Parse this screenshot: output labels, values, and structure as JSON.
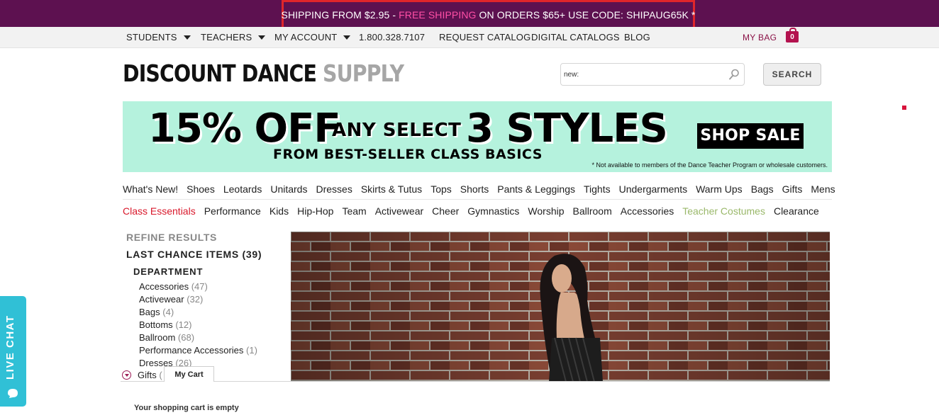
{
  "promo": {
    "part1": "SHIPPING FROM $2.95 - ",
    "highlight": "FREE SHIPPING",
    "part2": " ON ORDERS $65+ USE CODE: SHIPAUG65K *"
  },
  "top_nav": {
    "students": "STUDENTS",
    "teachers": "TEACHERS",
    "my_account": "MY ACCOUNT",
    "phone": "1.800.328.7107",
    "request_catalog": "REQUEST CATALOG",
    "digital_catalogs": "DIGITAL CATALOGS",
    "blog": "BLOG",
    "my_bag": "MY BAG",
    "bag_count": "0"
  },
  "logo": {
    "dark": "DISCOUNT DANCE ",
    "light": "SUPPLY"
  },
  "search": {
    "value": "new:",
    "button": "SEARCH"
  },
  "banner": {
    "big1": "15% OFF",
    "mid": "ANY SELECT",
    "big2": "3 STYLES",
    "sub": "FROM BEST-SELLER CLASS BASICS",
    "button": "SHOP SALE",
    "note": "* Not available to members of the Dance Teacher Program or wholesale customers."
  },
  "categories_row1": [
    "What's New!",
    "Shoes",
    "Leotards",
    "Unitards",
    "Dresses",
    "Skirts & Tutus",
    "Tops",
    "Shorts",
    "Pants & Leggings",
    "Tights",
    "Undergarments",
    "Warm Ups",
    "Bags",
    "Gifts",
    "Mens"
  ],
  "categories_row2": [
    "Class Essentials",
    "Performance",
    "Kids",
    "Hip-Hop",
    "Team",
    "Activewear",
    "Cheer",
    "Gymnastics",
    "Worship",
    "Ballroom",
    "Accessories",
    "Teacher Costumes",
    "Clearance"
  ],
  "sidebar": {
    "refine": "REFINE RESULTS",
    "last_chance": "LAST CHANCE ITEMS (39)",
    "department": "DEPARTMENT",
    "items": [
      {
        "label": "Accessories",
        "count": "(47)"
      },
      {
        "label": "Activewear",
        "count": "(32)"
      },
      {
        "label": "Bags",
        "count": "(4)"
      },
      {
        "label": "Bottoms",
        "count": "(12)"
      },
      {
        "label": "Ballroom",
        "count": "(68)"
      },
      {
        "label": "Performance Accessories",
        "count": "(1)"
      },
      {
        "label": "Dresses",
        "count": "(26)"
      }
    ],
    "gifts_label": "Gifts",
    "gifts_count": "("
  },
  "cart": {
    "tab": "My Cart",
    "empty": "Your shopping cart is empty"
  },
  "live_chat": {
    "label": "LIVE CHAT"
  },
  "colors": {
    "promo_bg": "#5d1150",
    "promo_highlight": "#ff4fa6",
    "banner_bg": "#b5f2dd",
    "brand_red": "#d9182b",
    "teal_chat": "#30c0d6"
  },
  "icons": [
    "search-icon",
    "bag-icon",
    "caret-down-icon",
    "expand-icon",
    "chat-bubble-icon"
  ]
}
